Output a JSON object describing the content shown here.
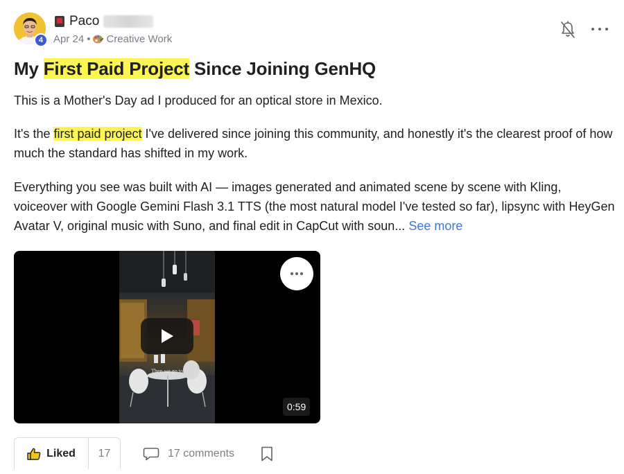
{
  "author": {
    "name": "Paco",
    "level": "4",
    "date": "Apr 24",
    "separator": "•",
    "category": "Creative Work"
  },
  "post": {
    "title_parts": [
      "My ",
      "First Paid Project",
      " Since Joining GenHQ"
    ],
    "paragraph_1": "This is a Mother's Day ad I produced for an optical store in Mexico.",
    "paragraph_2_parts": [
      "It's the ",
      "first paid project",
      " I've delivered since joining this community, and honestly it's the clearest proof of how much the standard has shifted in my work."
    ],
    "paragraph_3": "Everything you see was built with AI — images generated and animated scene by scene with Kling, voiceover with Google Gemini Flash 3.1 TTS (the most natural model I've tested so far), lipsync with HeyGen Avatar V, original music with Suno, and final edit in CapCut with soun...",
    "see_more": "See more"
  },
  "video": {
    "caption": "Then we go to",
    "duration": "0:59"
  },
  "actions": {
    "liked_label": "Liked",
    "like_count": "17",
    "comments_label": "17 comments"
  },
  "icons": {
    "flag": "flag-icon",
    "palette": "palette-icon",
    "bell": "bell-off-icon",
    "more": "more-horizontal-icon",
    "play": "play-icon",
    "thumbs_up": "thumbs-up-icon",
    "comment": "comment-icon",
    "bookmark": "bookmark-icon"
  },
  "colors": {
    "highlight": "#fdf455",
    "link": "#3a78d8",
    "level_badge": "#3b5bdb",
    "muted_text": "#7a7f87"
  }
}
